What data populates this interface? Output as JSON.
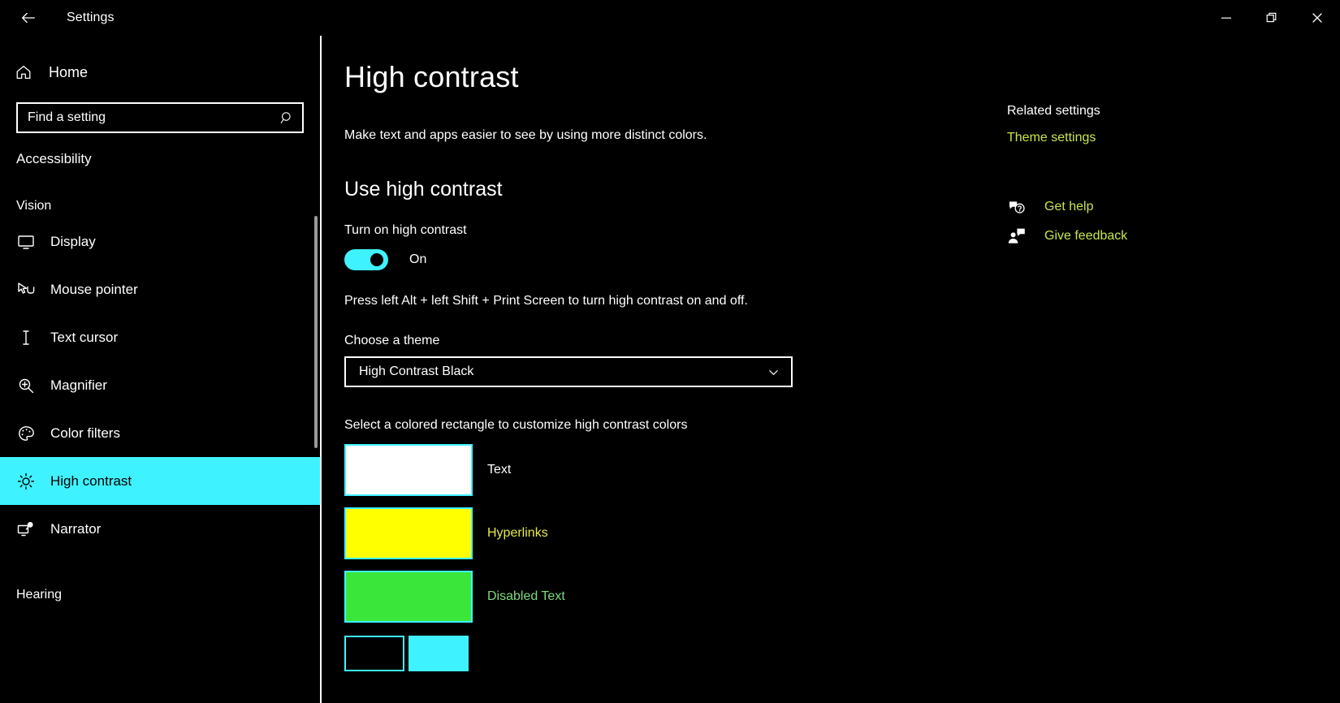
{
  "window": {
    "app_title": "Settings",
    "back_icon": "back-arrow-icon",
    "minimize_label": "Minimize",
    "restore_label": "Restore",
    "close_label": "Close"
  },
  "sidebar": {
    "home_label": "Home",
    "home_icon": "home-icon",
    "search": {
      "placeholder": "Find a setting",
      "value": "",
      "icon": "search-icon"
    },
    "category": "Accessibility",
    "groups": [
      {
        "label": "Vision",
        "items": [
          {
            "label": "Display",
            "icon": "monitor-icon",
            "selected": false
          },
          {
            "label": "Mouse pointer",
            "icon": "mouse-pointer-icon",
            "selected": false
          },
          {
            "label": "Text cursor",
            "icon": "text-cursor-icon",
            "selected": false
          },
          {
            "label": "Magnifier",
            "icon": "magnifier-icon",
            "selected": false
          },
          {
            "label": "Color filters",
            "icon": "palette-icon",
            "selected": false
          },
          {
            "label": "High contrast",
            "icon": "brightness-sun-icon",
            "selected": true
          },
          {
            "label": "Narrator",
            "icon": "narrator-icon",
            "selected": false
          }
        ]
      },
      {
        "label": "Hearing",
        "items": []
      }
    ]
  },
  "main": {
    "page_title": "High contrast",
    "description": "Make text and apps easier to see by using more distinct colors.",
    "section_heading": "Use high contrast",
    "toggle_label": "Turn on high contrast",
    "toggle_state": "On",
    "shortcut_hint": "Press left Alt + left Shift + Print Screen to turn high contrast on and off.",
    "theme_label": "Choose a theme",
    "theme_value": "High Contrast Black",
    "theme_chevron_icon": "chevron-down-icon",
    "swatch_caption": "Select a colored rectangle to customize high contrast colors",
    "swatches": [
      {
        "label": "Text",
        "color": "#FFFFFF",
        "label_color": "#FFFFFF",
        "border": "#3FF2FF"
      },
      {
        "label": "Hyperlinks",
        "color": "#FFFF00",
        "label_color": "#E8E84A",
        "border": "#3FF2FF"
      },
      {
        "label": "Disabled Text",
        "color": "#3BE63B",
        "label_color": "#7FD97F",
        "border": "#3FF2FF"
      }
    ],
    "swatches_partial": [
      {
        "label": "",
        "color": "#000000",
        "border": "#3FF2FF"
      },
      {
        "label": "",
        "color": "#3FF2FF",
        "border": "#3FF2FF"
      }
    ]
  },
  "right": {
    "related_title": "Related settings",
    "related_link": "Theme settings",
    "help_items": [
      {
        "label": "Get help",
        "icon": "question-bubble-icon"
      },
      {
        "label": "Give feedback",
        "icon": "feedback-person-icon"
      }
    ]
  },
  "colors": {
    "accent": "#3FF2FF",
    "link": "#C8E64C",
    "background": "#000000",
    "text": "#FFFFFF"
  }
}
